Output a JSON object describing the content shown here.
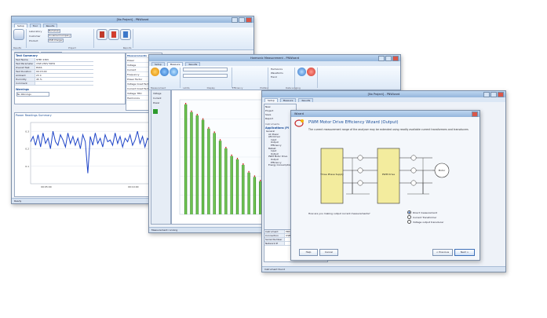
{
  "win1": {
    "title": "[No Project] - PNWizard",
    "tabs": [
      "Setup",
      "Tool",
      "Results"
    ],
    "tab_active": 0,
    "ribbon_labels": [
      "Laboratory",
      "Customer",
      "Product"
    ],
    "ribbon_values": [
      "Nameless",
      "Unnamed Company",
      "USB Charger"
    ],
    "ribbon_groups": [
      "Results",
      "Project",
      "Reports"
    ],
    "panel_tabs": [
      "Results Summary",
      "Raw Readings"
    ],
    "summary_heading": "Test Summary",
    "summary_rows": [
      {
        "k": "Test Name",
        "v": "STBY 230V"
      },
      {
        "k": "Test Parameter Range",
        "v": "15W 230V 50Hz"
      },
      {
        "k": "Overall Test Status",
        "v": "PASS"
      },
      {
        "k": "Test Duration",
        "v": "00:15:00"
      },
      {
        "k": "Ambient Temperature",
        "v": "23 C"
      },
      {
        "k": "Humidity",
        "v": "45 %"
      },
      {
        "k": "Comment",
        "v": ""
      }
    ],
    "side_labels": [
      "Measurements",
      "Power",
      "Voltage",
      "Current",
      "Frequency",
      "Power Factor",
      "Voltage Crest Factor",
      "Current Crest Factor",
      "Voltage THD",
      "Harmonics"
    ],
    "warnings_heading": "Warnings",
    "warnings_value": "No Warnings",
    "chart_title": "Power Readings Summary",
    "chart_legend": "Total Graph",
    "x_labels": [
      "00:05:00",
      "00:10:00"
    ],
    "x_axis_label": "Time",
    "y_labels": [
      "0.3",
      "0.2",
      "0.1"
    ],
    "status": "Ready",
    "chart_data": {
      "type": "line",
      "series": [
        {
          "values": [
            0.24,
            0.27,
            0.22,
            0.28,
            0.21,
            0.29,
            0.23,
            0.26,
            0.2,
            0.3,
            0.24,
            0.22,
            0.28,
            0.25,
            0.21,
            0.29,
            0.23,
            0.27,
            0.22,
            0.26,
            0.2,
            0.28,
            0.24,
            0.06,
            0.27,
            0.22,
            0.29,
            0.23,
            0.26,
            0.21,
            0.28,
            0.24,
            0.25,
            0.22,
            0.29,
            0.23,
            0.27,
            0.21,
            0.26,
            0.24,
            0.28,
            0.22,
            0.25,
            0.3,
            0.23,
            0.27,
            0.21,
            0.26,
            0.24,
            0.28,
            0.22,
            0.25,
            0.29,
            0.23,
            0.27,
            0.21,
            0.24,
            0.26,
            0.28,
            0.22,
            0.25,
            0.23,
            0.27,
            0.21,
            0.29,
            0.24
          ]
        }
      ],
      "ylim": [
        0,
        0.35
      ]
    }
  },
  "win2": {
    "title": "Harmonic Measurement - PNWizard",
    "tabs": [
      "Setup",
      "Measure",
      "Results"
    ],
    "tab_active": 1,
    "ribbon_groups": [
      "Measurement",
      "Limits",
      "Display",
      "Efficiency",
      "Plotting",
      "Data Logging"
    ],
    "ribbon_options": [
      "Harmonics",
      "Waveforms",
      "Trend"
    ],
    "ribbon_buttons": [
      "Stop",
      "Reset",
      "Setup",
      "Snapshot",
      "Record"
    ],
    "chart_legend": "Harmonics",
    "chart_legend2": "Limit",
    "left_options": [
      "Voltage",
      "Current",
      "Power"
    ],
    "status": "Measurement running",
    "chart_data": {
      "type": "bar",
      "categories": [
        "1",
        "2",
        "3",
        "4",
        "5",
        "6",
        "7",
        "8",
        "9",
        "10",
        "11",
        "12",
        "13",
        "14",
        "15",
        "16",
        "17",
        "18",
        "19",
        "20"
      ],
      "series": [
        {
          "values": [
            1.0,
            0.93,
            0.9,
            0.86,
            0.78,
            0.74,
            0.67,
            0.6,
            0.53,
            0.5,
            0.45,
            0.38,
            0.34,
            0.3,
            0.25,
            0.22,
            0.18,
            0.15,
            0.13,
            0.11
          ]
        }
      ],
      "ylim": [
        0,
        1.0
      ]
    }
  },
  "win3": {
    "title": "[No Project] - PNWizard",
    "tabs": [
      "Setup",
      "Measure",
      "Results"
    ],
    "tab_active": 0,
    "left_top_items": [
      "New",
      "Project",
      "Save",
      "Report"
    ],
    "left_label": "Instruments",
    "apps_heading": "Applications (Pl",
    "tree": [
      "General",
      "AC Power",
      "LED Driver",
      "Input",
      "Output",
      "Efficiency",
      "Ballast",
      "Input",
      "Output",
      "PWM Motor Drive",
      "Output",
      "Efficiency",
      "Energy Consumption"
    ],
    "bottom_rows": [
      {
        "k": "Instrument",
        "v": "PPA5530"
      },
      {
        "k": "Connection",
        "v": "USB"
      },
      {
        "k": "Serial Number",
        "v": ""
      },
      {
        "k": "Network IP",
        "v": ""
      }
    ],
    "status": "Instrument found"
  },
  "dialog": {
    "title": "Wizard",
    "heading": "PWM Motor Drive Efficiency Wizard (Output)",
    "body": "The current measurement range of the analyser may be extended using readily available current transformers and transducers",
    "question": "How are you making output current measurements?",
    "options": [
      "Direct measurement",
      "Current Transformer",
      "Voltage output transducer"
    ],
    "selected_option": 0,
    "block_labels": [
      "Three Phase Supply",
      "PWM Drive",
      "Motor"
    ],
    "buttons": [
      "Help",
      "Cancel",
      "< Previous",
      "Next >"
    ],
    "colors": {
      "block": "#f3ec9e",
      "accent": "#1c55b5",
      "wire": "#303030"
    }
  }
}
